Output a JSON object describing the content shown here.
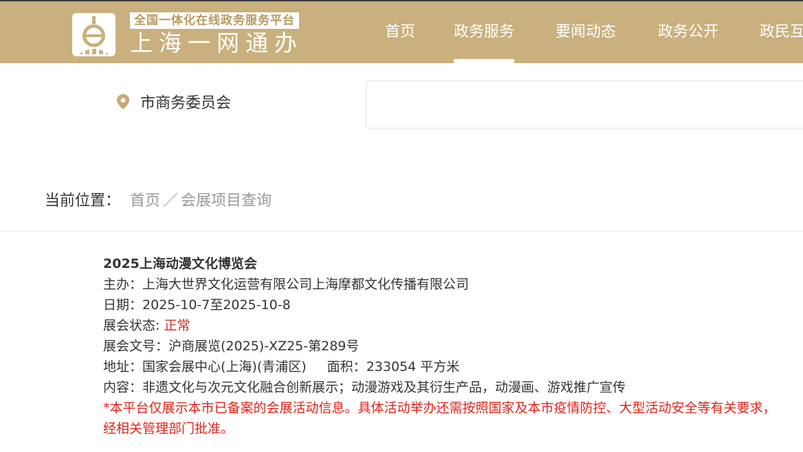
{
  "header": {
    "platform_tag": "全国一体化在线政务服务平台",
    "site_name": "上海一网通办",
    "logo_icon": "shanghai-e-logo",
    "nav": [
      {
        "label": "首页",
        "active": false
      },
      {
        "label": "政务服务",
        "active": true
      },
      {
        "label": "要闻动态",
        "active": false
      },
      {
        "label": "政务公开",
        "active": false
      },
      {
        "label": "政民互动",
        "active": false
      }
    ]
  },
  "location": {
    "icon": "map-pin-icon",
    "label": "市商务委员会"
  },
  "search": {
    "value": ""
  },
  "breadcrumb": {
    "label": "当前位置：",
    "home": "首页",
    "separator": "／",
    "current": "会展项目查询"
  },
  "exhibition": {
    "title": "2025上海动漫文化博览会",
    "organizer_label": "主办：",
    "organizer": "上海大世界文化运营有限公司上海摩都文化传播有限公司",
    "date_label": "日期：",
    "date": "2025-10-7至2025-10-8",
    "status_label": "展会状态: ",
    "status": "正常",
    "doc_label": "展会文号：",
    "doc_no": "沪商展览(2025)-XZ25-第289号",
    "address_label": "地址：",
    "address": "国家会展中心(上海)(青浦区)",
    "area_label": "面积：",
    "area": "233054 平方米",
    "content_label": "内容：",
    "content": "非遗文化与次元文化融合创新展示；动漫游戏及其衍生产品，动漫画、游戏推广宣传",
    "notice": "*本平台仅展示本市已备案的会展活动信息。具体活动举办还需按照国家及本市疫情防控、大型活动安全等有关要求，经相关管理部门批准。"
  },
  "colors": {
    "header_bg": "#c9b07e",
    "status": "#d42b1e",
    "notice": "#e0241a"
  }
}
